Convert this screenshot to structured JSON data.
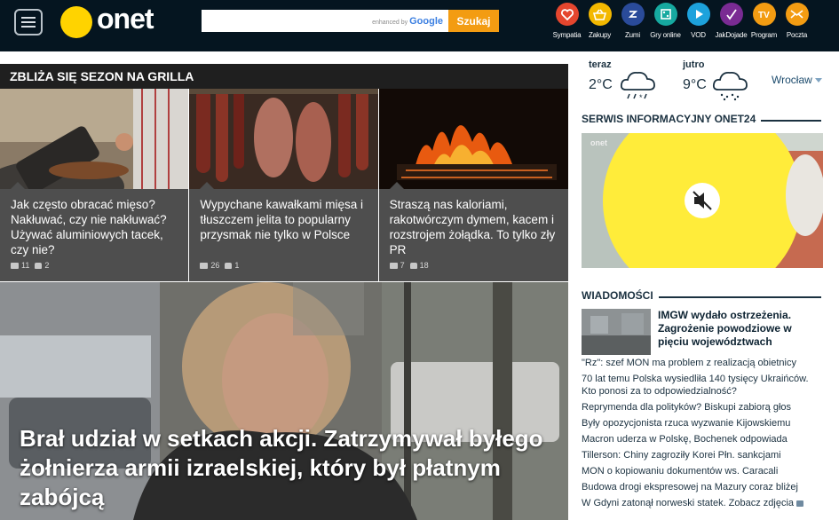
{
  "header": {
    "logo_text": "onet",
    "search_value": "",
    "search_enhanced_by": "enhanced by",
    "search_google": "Google",
    "search_button": "Szukaj",
    "services": [
      {
        "label": "Sympatia",
        "icon": "heart-icon",
        "color": "#e5462e"
      },
      {
        "label": "Zakupy",
        "icon": "basket-icon",
        "color": "#f3b800"
      },
      {
        "label": "Zumi",
        "icon": "zumi-icon",
        "color": "#2a4b9a"
      },
      {
        "label": "Gry online",
        "icon": "games-icon",
        "color": "#16a9a0"
      },
      {
        "label": "VOD",
        "icon": "play-icon",
        "color": "#1da2dc"
      },
      {
        "label": "JakDojade",
        "icon": "route-icon",
        "color": "#7a2b93"
      },
      {
        "label": "Program",
        "icon": "tv-icon",
        "color": "#f39c12"
      },
      {
        "label": "Poczta",
        "icon": "mail-icon",
        "color": "#f39c12"
      }
    ]
  },
  "promo": {
    "title": "ZBLIŻA SIĘ SEZON NA GRILLA",
    "tiles": [
      {
        "text": "Jak często obracać mięso? Nakłuwać, czy nie nakłuwać? Używać aluminiowych tacek, czy nie?",
        "comments": "11",
        "likes": "2"
      },
      {
        "text": "Wypychane kawałkami mięsa i tłuszczem jelita to popularny przysmak nie tylko w Polsce",
        "comments": "26",
        "likes": "1"
      },
      {
        "text": "Straszą nas kaloriami, rakotwórczym dymem, kacem i rozstrojem żołądka. To tylko zły PR",
        "comments": "7",
        "likes": "18"
      }
    ]
  },
  "hero": {
    "headline": "Brał udział w setkach akcji. Zatrzymywał byłego żołnierza armii izraelskiej, który był płatnym zabójcą"
  },
  "weather": {
    "today_label": "teraz",
    "today_temp": "2°C",
    "tomorrow_label": "jutro",
    "tomorrow_temp": "9°C",
    "city": "Wrocław"
  },
  "onet24": {
    "title": "SERWIS INFORMACYJNY ONET24",
    "video_brand": "onet"
  },
  "news": {
    "title": "WIADOMOŚCI",
    "top_title": "IMGW wydało ostrzeżenia. Zagrożenie powodziowe w pięciu województwach",
    "items": [
      "\"Rz\": szef MON ma problem z realizacją obietnicy",
      "70 lat temu Polska wysiedliła 140 tysięcy Ukraińców. Kto ponosi za to odpowiedzialność?",
      "Reprymenda dla polityków? Biskupi zabiorą głos",
      "Były opozycjonista rzuca wyzwanie Kijowskiemu",
      "Macron uderza w Polskę, Bochenek odpowiada",
      "Tillerson: Chiny zagroziły Korei Płn. sankcjami",
      "MON o kopiowaniu dokumentów ws. Caracali",
      "Budowa drogi ekspresowej na Mazury coraz bliżej",
      "W Gdyni zatonął norweski statek. Zobacz zdjęcia"
    ]
  }
}
